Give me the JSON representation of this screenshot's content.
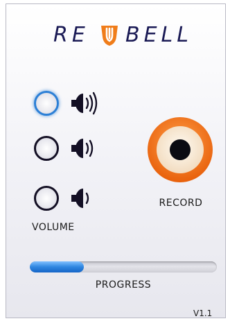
{
  "brand": {
    "logo_left": "RE",
    "logo_right": "BELL",
    "text_color": "#1a1a55",
    "mark_color": "#f07d1a"
  },
  "volume": {
    "label": "VOLUME",
    "options": [
      {
        "level": "high",
        "selected": true,
        "icon": "speaker-high-icon"
      },
      {
        "level": "medium",
        "selected": false,
        "icon": "speaker-medium-icon"
      },
      {
        "level": "low",
        "selected": false,
        "icon": "speaker-low-icon"
      }
    ],
    "selected_color": "#2b7fd6"
  },
  "record": {
    "label": "RECORD",
    "icon": "record-icon",
    "accent_color": "#f07d1a"
  },
  "progress": {
    "label": "PROGRESS",
    "fraction": 0.29,
    "fill_color": "#2f86e0"
  },
  "version": "V1.1"
}
